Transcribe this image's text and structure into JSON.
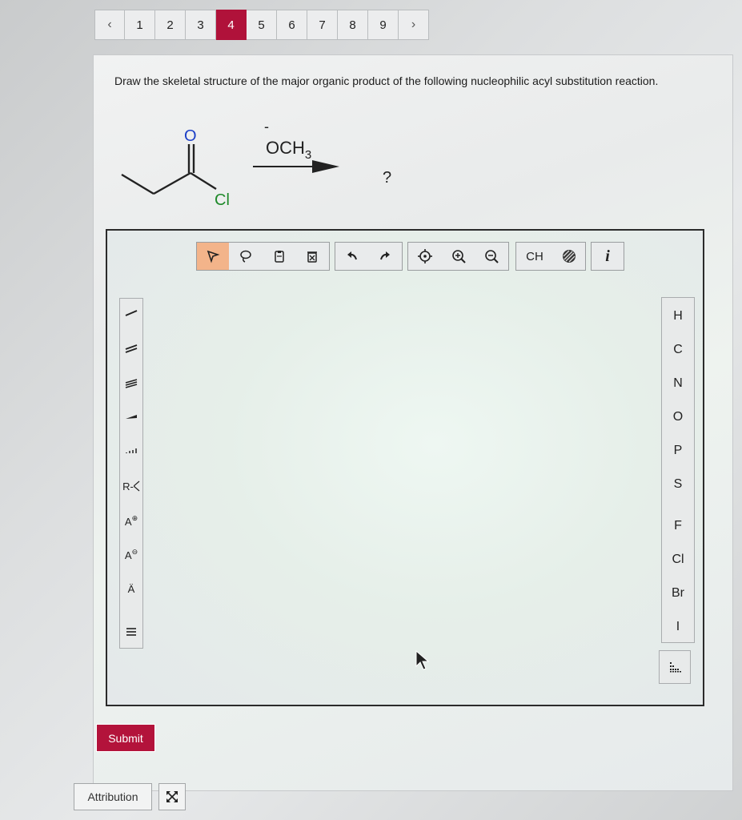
{
  "pagination": {
    "prev": "‹",
    "next": "›",
    "pages": [
      "1",
      "2",
      "3",
      "4",
      "5",
      "6",
      "7",
      "8",
      "9"
    ],
    "active": "4"
  },
  "question": {
    "text": "Draw the skeletal structure of the major organic product of the following nucleophilic acyl substitution reaction."
  },
  "reaction": {
    "carbonyl_o": "O",
    "leaving_group": "Cl",
    "reagent_charge": "-",
    "reagent_main": "OCH",
    "reagent_sub": "3",
    "product": "?"
  },
  "toolbar": {
    "group1": [
      "select-arrow-icon",
      "lasso-icon",
      "clipboard-icon",
      "delete-icon"
    ],
    "group2": [
      "undo-icon",
      "redo-icon"
    ],
    "group3": [
      "center-icon",
      "zoom-in-icon",
      "zoom-out-icon"
    ],
    "ch_label": "CH",
    "info_label": "i"
  },
  "left_tools": {
    "r_group": "R-",
    "cation": "A",
    "anion": "A",
    "lone_pair": "Ä"
  },
  "elements": [
    "H",
    "C",
    "N",
    "O",
    "P",
    "S",
    "F",
    "Cl",
    "Br",
    "I"
  ],
  "buttons": {
    "submit": "Submit",
    "attribution": "Attribution"
  },
  "colors": {
    "accent": "#b0123a",
    "oxygen": "#1c3fc7",
    "chlorine": "#1f8a2a",
    "selected_tool": "#f3b48a"
  }
}
